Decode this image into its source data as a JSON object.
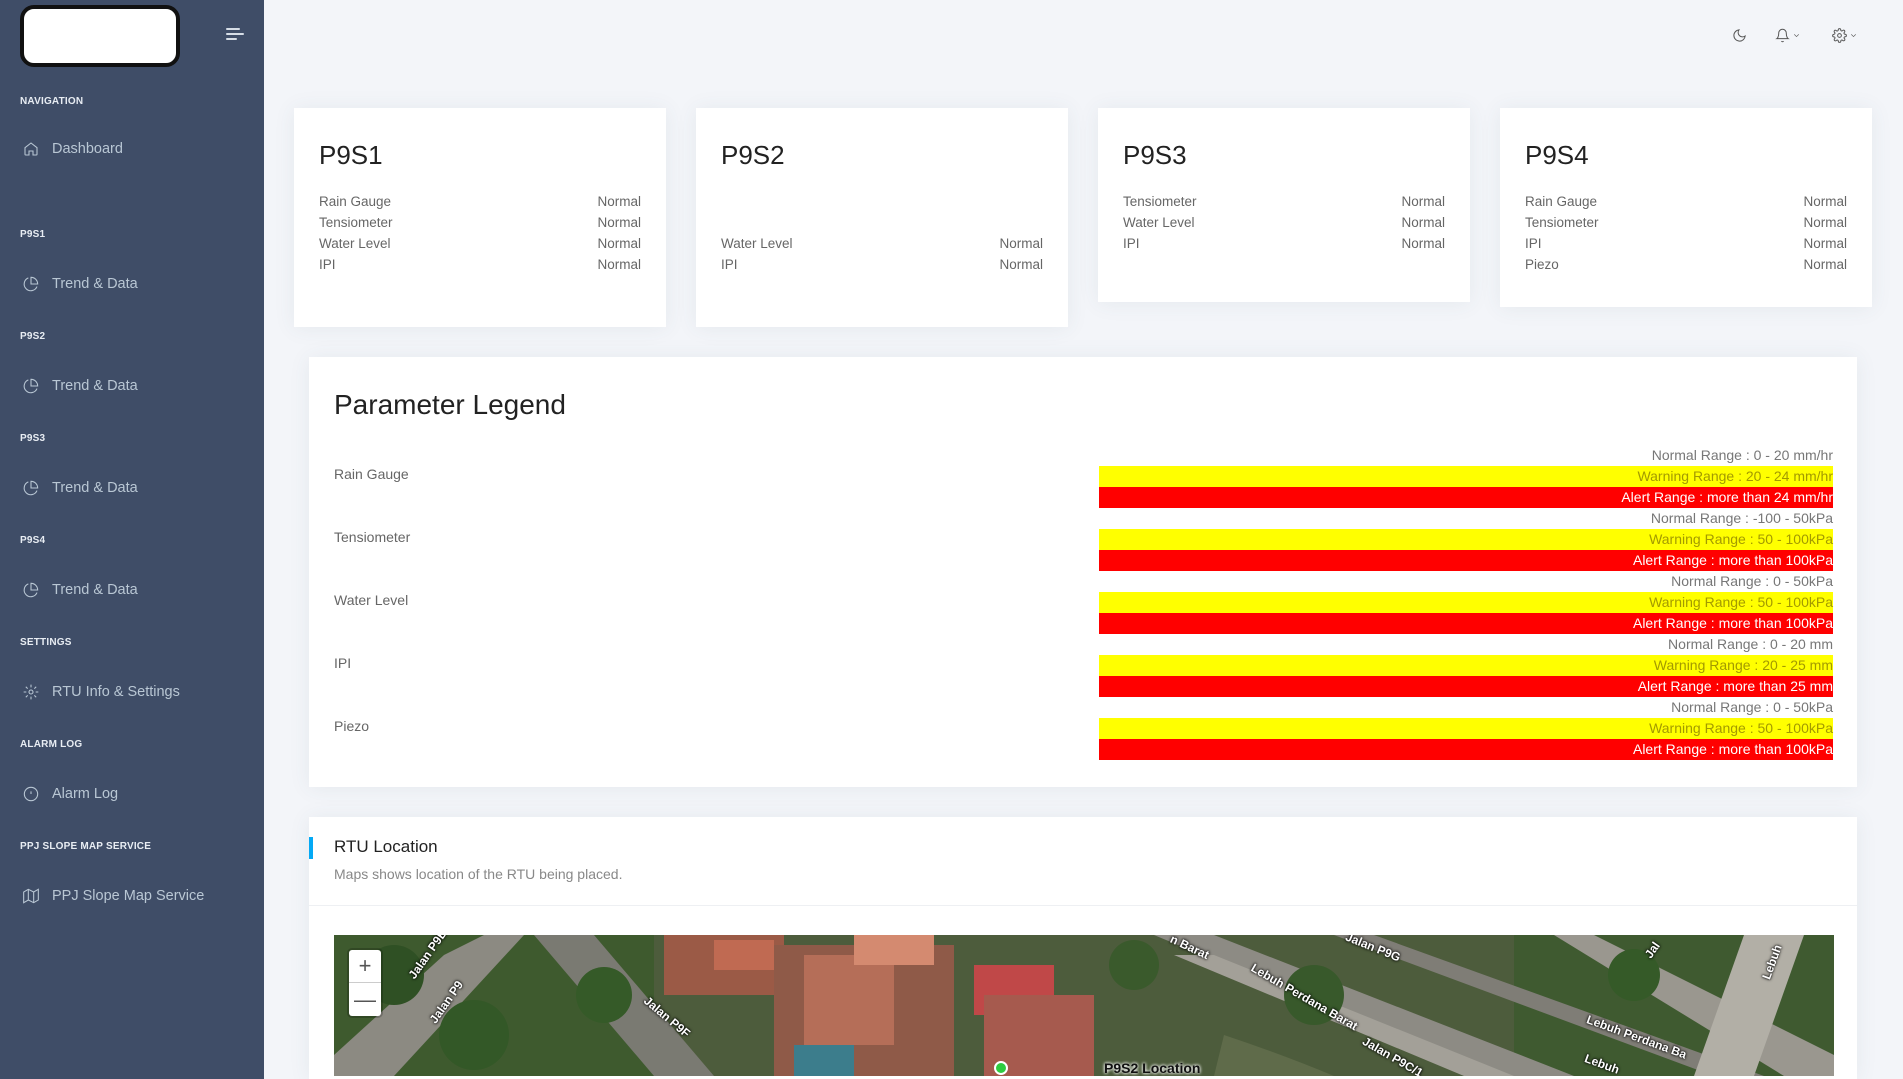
{
  "sidebar": {
    "sections": [
      {
        "caption": "NAVIGATION",
        "item": "Dashboard",
        "icon": "home-icon"
      },
      {
        "caption": "P9S1",
        "item": "Trend & Data",
        "icon": "pie-chart-icon"
      },
      {
        "caption": "P9S2",
        "item": "Trend & Data",
        "icon": "pie-chart-icon"
      },
      {
        "caption": "P9S3",
        "item": "Trend & Data",
        "icon": "pie-chart-icon"
      },
      {
        "caption": "P9S4",
        "item": "Trend & Data",
        "icon": "pie-chart-icon"
      },
      {
        "caption": "SETTINGS",
        "item": "RTU Info & Settings",
        "icon": "gear-icon"
      },
      {
        "caption": "ALARM LOG",
        "item": "Alarm Log",
        "icon": "alert-circle-icon"
      },
      {
        "caption": "PPJ SLOPE MAP SERVICE",
        "item": "PPJ Slope Map Service",
        "icon": "map-icon"
      }
    ]
  },
  "header": {
    "icons": [
      "moon-icon",
      "bell-icon",
      "settings-icon"
    ]
  },
  "stations": [
    {
      "name": "P9S1",
      "rows": [
        {
          "label": "Rain Gauge",
          "status": "Normal"
        },
        {
          "label": "Tensiometer",
          "status": "Normal"
        },
        {
          "label": "Water Level",
          "status": "Normal"
        },
        {
          "label": "IPI",
          "status": "Normal"
        }
      ]
    },
    {
      "name": "P9S2",
      "rows": [
        {
          "label": "Water Level",
          "status": "Normal"
        },
        {
          "label": "IPI",
          "status": "Normal"
        }
      ]
    },
    {
      "name": "P9S3",
      "rows": [
        {
          "label": "Tensiometer",
          "status": "Normal"
        },
        {
          "label": "Water Level",
          "status": "Normal"
        },
        {
          "label": "IPI",
          "status": "Normal"
        }
      ]
    },
    {
      "name": "P9S4",
      "rows": [
        {
          "label": "Rain Gauge",
          "status": "Normal"
        },
        {
          "label": "Tensiometer",
          "status": "Normal"
        },
        {
          "label": "IPI",
          "status": "Normal"
        },
        {
          "label": "Piezo",
          "status": "Normal"
        }
      ]
    }
  ],
  "legend": {
    "title": "Parameter Legend",
    "params": [
      {
        "name": "Rain Gauge",
        "normal": "Normal Range : 0 - 20 mm/hr",
        "warning": "Warning Range : 20 - 24 mm/hr",
        "alert": "Alert Range : more than 24 mm/hr"
      },
      {
        "name": "Tensiometer",
        "normal": "Normal Range : -100 - 50kPa",
        "warning": "Warning Range : 50 - 100kPa",
        "alert": "Alert Range : more than 100kPa"
      },
      {
        "name": "Water Level",
        "normal": "Normal Range : 0 - 50kPa",
        "warning": "Warning Range : 50 - 100kPa",
        "alert": "Alert Range : more than 100kPa"
      },
      {
        "name": "IPI",
        "normal": "Normal Range : 0 - 20 mm",
        "warning": "Warning Range : 20 - 25 mm",
        "alert": "Alert Range : more than 25 mm"
      },
      {
        "name": "Piezo",
        "normal": "Normal Range : 0 - 50kPa",
        "warning": "Warning Range : 50 - 100kPa",
        "alert": "Alert Range : more than 100kPa"
      }
    ],
    "colors": {
      "warning": "#ffff00",
      "alert": "#ff0000"
    }
  },
  "location": {
    "title": "RTU Location",
    "subtitle": "Maps shows location of the RTU being placed.",
    "zoom_in": "+",
    "zoom_out": "—",
    "labels": [
      "Jalan P9B",
      "Jalan P9",
      "Jalan P9F",
      "n Barat",
      "Jalan P9G",
      "Lebuh Perdana Barat",
      "Lebuh Perdana Ba",
      "Jalan P9C/1",
      "Lebuh",
      "Jal",
      "Lebuh"
    ],
    "marker": "P9S2 Location"
  },
  "accent": "#04a9f5"
}
